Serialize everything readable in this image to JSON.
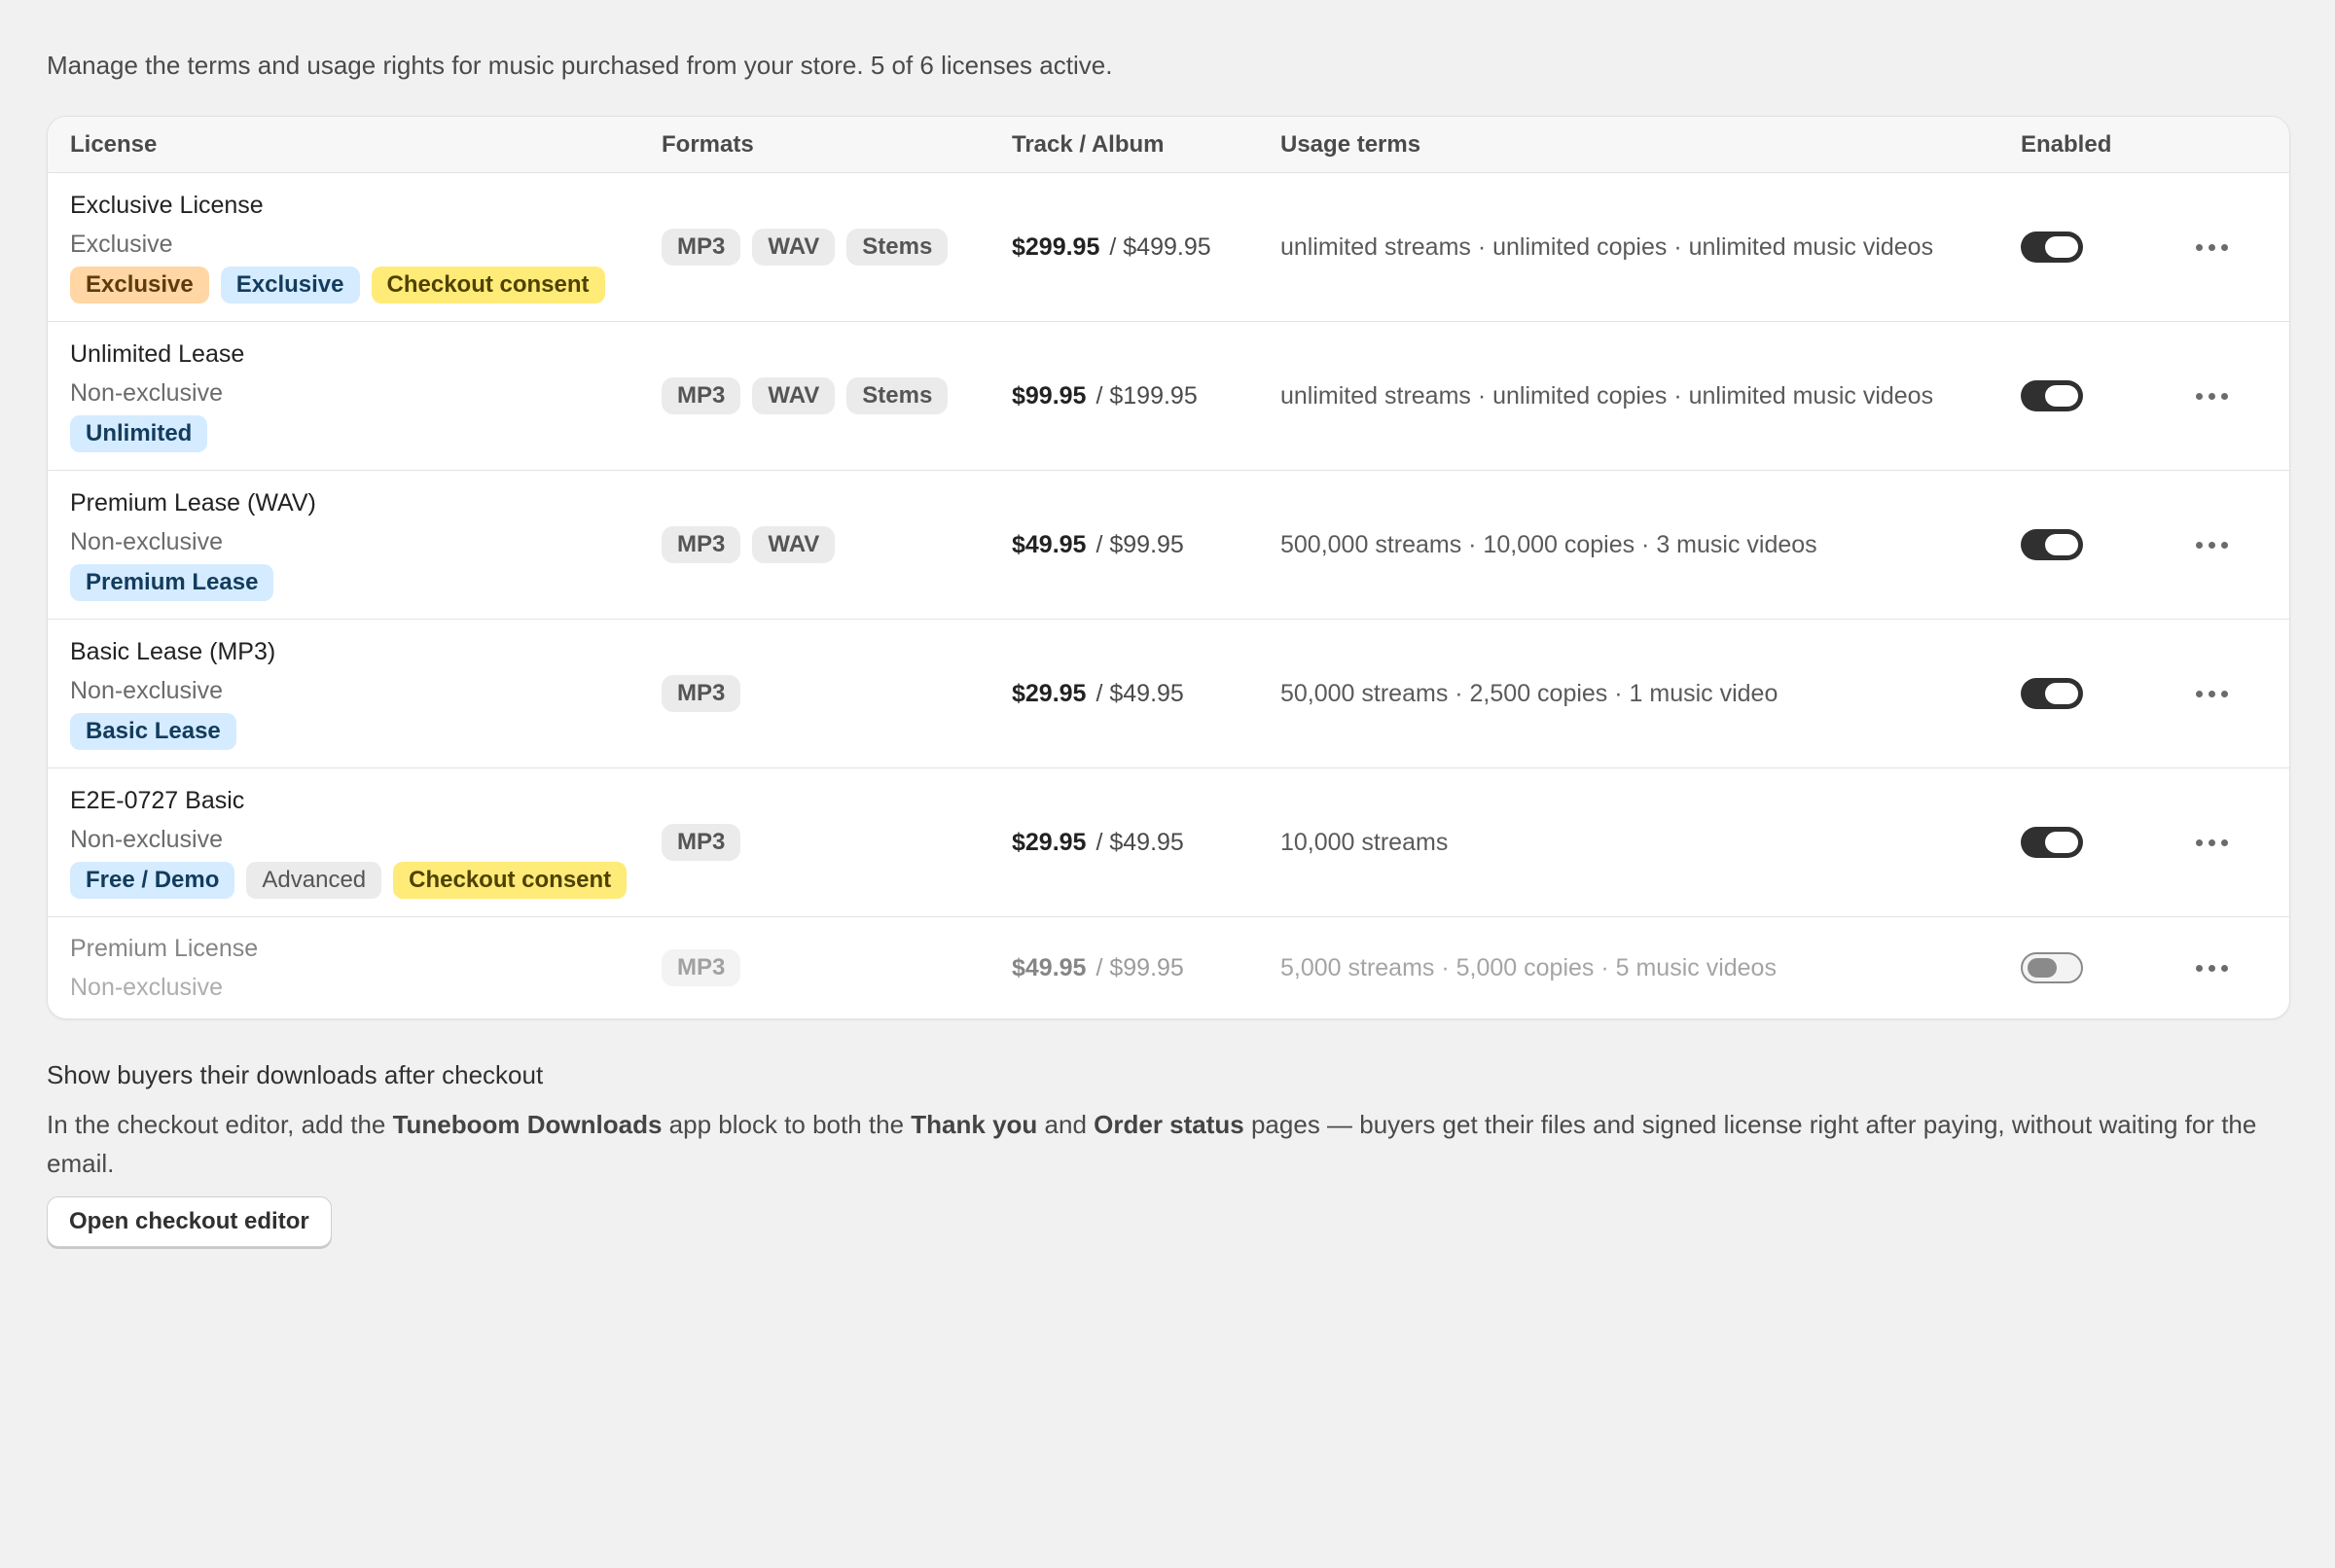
{
  "intro_text": "Manage the terms and usage rights for music purchased from your store. 5 of 6 licenses active.",
  "table": {
    "headers": {
      "license": "License",
      "formats": "Formats",
      "price": "Track / Album",
      "usage": "Usage terms",
      "enabled": "Enabled"
    },
    "rows": [
      {
        "name": "Exclusive License",
        "type": "Exclusive",
        "badges": [
          {
            "label": "Exclusive",
            "color": "#ffd6a4"
          },
          {
            "label": "Exclusive",
            "color": "#d5ebff"
          },
          {
            "label": "Checkout consent",
            "color": "#ffeb78"
          }
        ],
        "formats": [
          "MP3",
          "WAV",
          "Stems"
        ],
        "track_price": "$299.95",
        "album_price": "/ $499.95",
        "usage": "unlimited streams · unlimited copies · unlimited music videos",
        "enabled": true
      },
      {
        "name": "Unlimited Lease",
        "type": "Non-exclusive",
        "badges": [
          {
            "label": "Unlimited",
            "color": "#d5ebff"
          }
        ],
        "formats": [
          "MP3",
          "WAV",
          "Stems"
        ],
        "track_price": "$99.95",
        "album_price": "/ $199.95",
        "usage": "unlimited streams · unlimited copies · unlimited music videos",
        "enabled": true
      },
      {
        "name": "Premium Lease (WAV)",
        "type": "Non-exclusive",
        "badges": [
          {
            "label": "Premium Lease",
            "color": "#d5ebff"
          }
        ],
        "formats": [
          "MP3",
          "WAV"
        ],
        "track_price": "$49.95",
        "album_price": "/ $99.95",
        "usage": "500,000 streams · 10,000 copies · 3 music videos",
        "enabled": true
      },
      {
        "name": "Basic Lease (MP3)",
        "type": "Non-exclusive",
        "badges": [
          {
            "label": "Basic Lease",
            "color": "#d5ebff"
          }
        ],
        "formats": [
          "MP3"
        ],
        "track_price": "$29.95",
        "album_price": "/ $49.95",
        "usage": "50,000 streams · 2,500 copies · 1 music video",
        "enabled": true
      },
      {
        "name": "E2E-0727 Basic",
        "type": "Non-exclusive",
        "badges": [
          {
            "label": "Free / Demo",
            "color": "#d5ebff"
          },
          {
            "label": "Advanced",
            "color": "#ebebeb"
          },
          {
            "label": "Checkout consent",
            "color": "#ffeb78"
          }
        ],
        "formats": [
          "MP3"
        ],
        "track_price": "$29.95",
        "album_price": "/ $49.95",
        "usage": "10,000 streams",
        "enabled": true
      },
      {
        "name": "Premium License",
        "type": "Non-exclusive",
        "badges": [],
        "formats": [
          "MP3"
        ],
        "track_price": "$49.95",
        "album_price": "/ $99.95",
        "usage": "5,000 streams · 5,000 copies · 5 music videos",
        "enabled": false
      }
    ]
  },
  "downloads_section": {
    "title": "Show buyers their downloads after checkout",
    "body_1": "In the checkout editor, add the ",
    "body_b1": "Tuneboom Downloads",
    "body_2": " app block to both the ",
    "body_b2": "Thank you",
    "body_3": " and ",
    "body_b3": "Order status",
    "body_4": " pages — buyers get their files and signed license right after paying, without waiting for the email.",
    "button_label": "Open checkout editor"
  },
  "icons": {
    "row_menu": "more-horizontal-icon"
  }
}
